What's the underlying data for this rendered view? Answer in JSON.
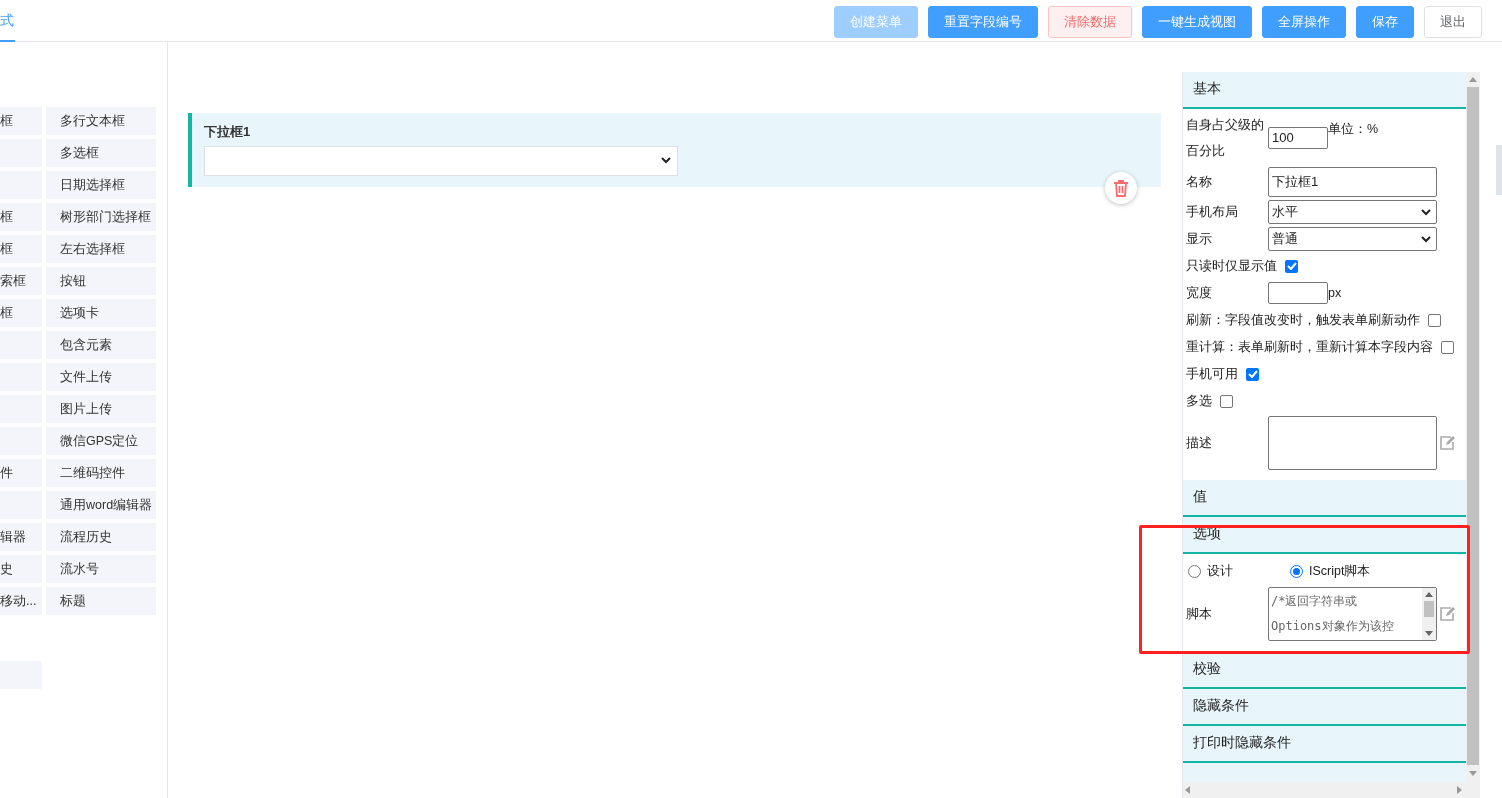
{
  "tab": {
    "label": "式",
    "selected": true
  },
  "toolbar": [
    {
      "label": "创建菜单",
      "kind": "primary",
      "disabled": true
    },
    {
      "label": "重置字段编号",
      "kind": "primary",
      "disabled": false
    },
    {
      "label": "清除数据",
      "kind": "danger",
      "disabled": false
    },
    {
      "label": "一键生成视图",
      "kind": "primary",
      "disabled": false
    },
    {
      "label": "全屏操作",
      "kind": "primary",
      "disabled": false
    },
    {
      "label": "保存",
      "kind": "primary",
      "disabled": false
    },
    {
      "label": "退出",
      "kind": "plain",
      "disabled": false
    }
  ],
  "palette": [
    {
      "left": "框",
      "right": "多行文本框"
    },
    {
      "right": "多选框"
    },
    {
      "right": "日期选择框"
    },
    {
      "left": "框",
      "right": "树形部门选择框"
    },
    {
      "left": "框",
      "right": "左右选择框"
    },
    {
      "left": "索框",
      "right": "按钮"
    },
    {
      "left": "框",
      "right": "选项卡"
    },
    {
      "right": "包含元素"
    },
    {
      "right": "文件上传"
    },
    {
      "right": "图片上传"
    },
    {
      "right": "微信GPS定位"
    },
    {
      "left": "件",
      "right": "二维码控件"
    },
    {
      "right": "通用word编辑器"
    },
    {
      "left": "辑器",
      "right": "流程历史"
    },
    {
      "left": "史",
      "right": "流水号"
    },
    {
      "left": "移动...",
      "right": "标题"
    }
  ],
  "canvas": {
    "field": {
      "label": "下拉框1"
    }
  },
  "properties": {
    "sections": [
      {
        "title": "基本",
        "rows": [
          {
            "kind": "number",
            "label": "自身占父级的百分比",
            "value": "100",
            "suffix": "单位：%"
          },
          {
            "kind": "text",
            "label": "名称",
            "value": "下拉框1"
          },
          {
            "kind": "select",
            "label": "手机布局",
            "value": "水平"
          },
          {
            "kind": "select",
            "label": "显示",
            "value": "普通"
          },
          {
            "kind": "checkbox",
            "label": "只读时仅显示值",
            "checked": true
          },
          {
            "kind": "number",
            "label": "宽度",
            "value": "",
            "suffix": "px"
          },
          {
            "kind": "checkbox",
            "label": "刷新：字段值改变时，触发表单刷新动作",
            "checked": false
          },
          {
            "kind": "checkbox",
            "label": "重计算：表单刷新时，重新计算本字段内容",
            "checked": false
          },
          {
            "kind": "checkbox",
            "label": "手机可用",
            "checked": true
          },
          {
            "kind": "checkbox",
            "label": "多选",
            "checked": false
          },
          {
            "kind": "textarea",
            "label": "描述"
          }
        ]
      },
      {
        "title": "值"
      },
      {
        "title": "选项",
        "highlighted": true,
        "rows": [
          {
            "kind": "radio",
            "options": [
              {
                "label": "设计",
                "selected": false
              },
              {
                "label": "IScript脚本",
                "selected": true
              }
            ]
          },
          {
            "kind": "textarea",
            "label": "脚本",
            "lines": [
              "/*返回字符串或",
              "Options对象作为该控"
            ]
          }
        ]
      },
      {
        "title": "校验"
      },
      {
        "title": "隐藏条件"
      },
      {
        "title": "打印时隐藏条件"
      }
    ]
  }
}
